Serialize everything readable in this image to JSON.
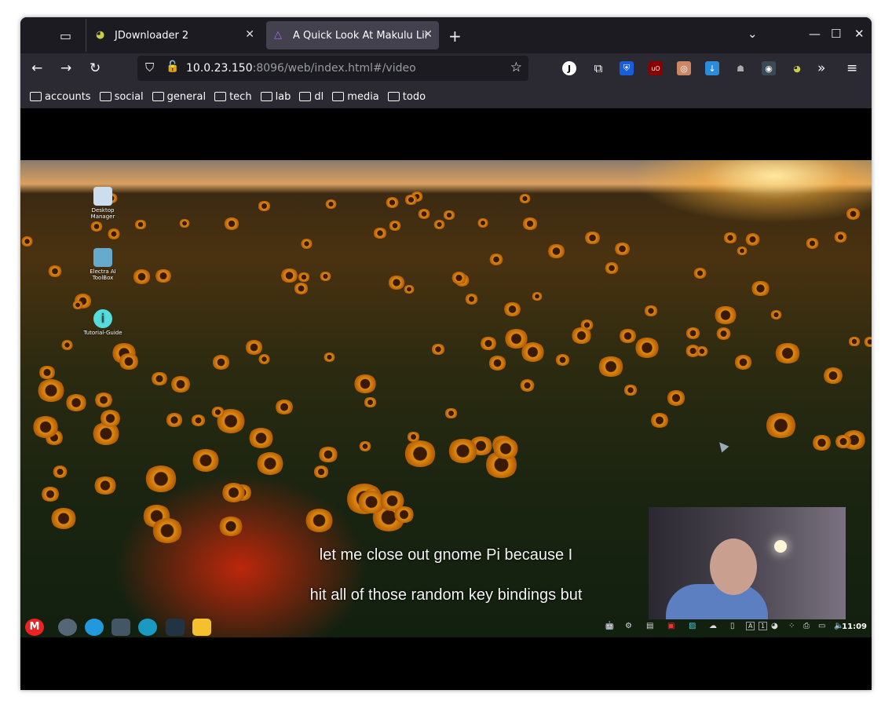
{
  "browser": {
    "tabs": [
      {
        "label": "JDownloader 2",
        "icon": "jdownloader-icon",
        "active": false
      },
      {
        "label": "A Quick Look At Makulu Linux",
        "icon": "jellyfin-icon",
        "active": true
      }
    ],
    "url_host": "10.0.23.150",
    "url_rest": ":8096/web/index.html#/video",
    "extensions": [
      "account-j-icon",
      "extensions-puzzle-icon",
      "bitwarden-icon",
      "ublock-origin-icon",
      "tampermonkey-icon",
      "file-download-icon",
      "incognito-icon",
      "privacy-badger-icon",
      "jdownloader-icon"
    ],
    "bookmarks": [
      "accounts",
      "social",
      "general",
      "tech",
      "lab",
      "dl",
      "media",
      "todo"
    ]
  },
  "video": {
    "desktop_icons": [
      {
        "label": "Desktop Manager"
      },
      {
        "label": "Electra AI ToolBox"
      },
      {
        "label": "Tutorial-Guide"
      }
    ],
    "subtitles": [
      "let me close out gnome Pi because I",
      "hit all of those random key bindings but"
    ],
    "clock": "11:09",
    "tray_kbd": [
      "A",
      "1"
    ]
  }
}
